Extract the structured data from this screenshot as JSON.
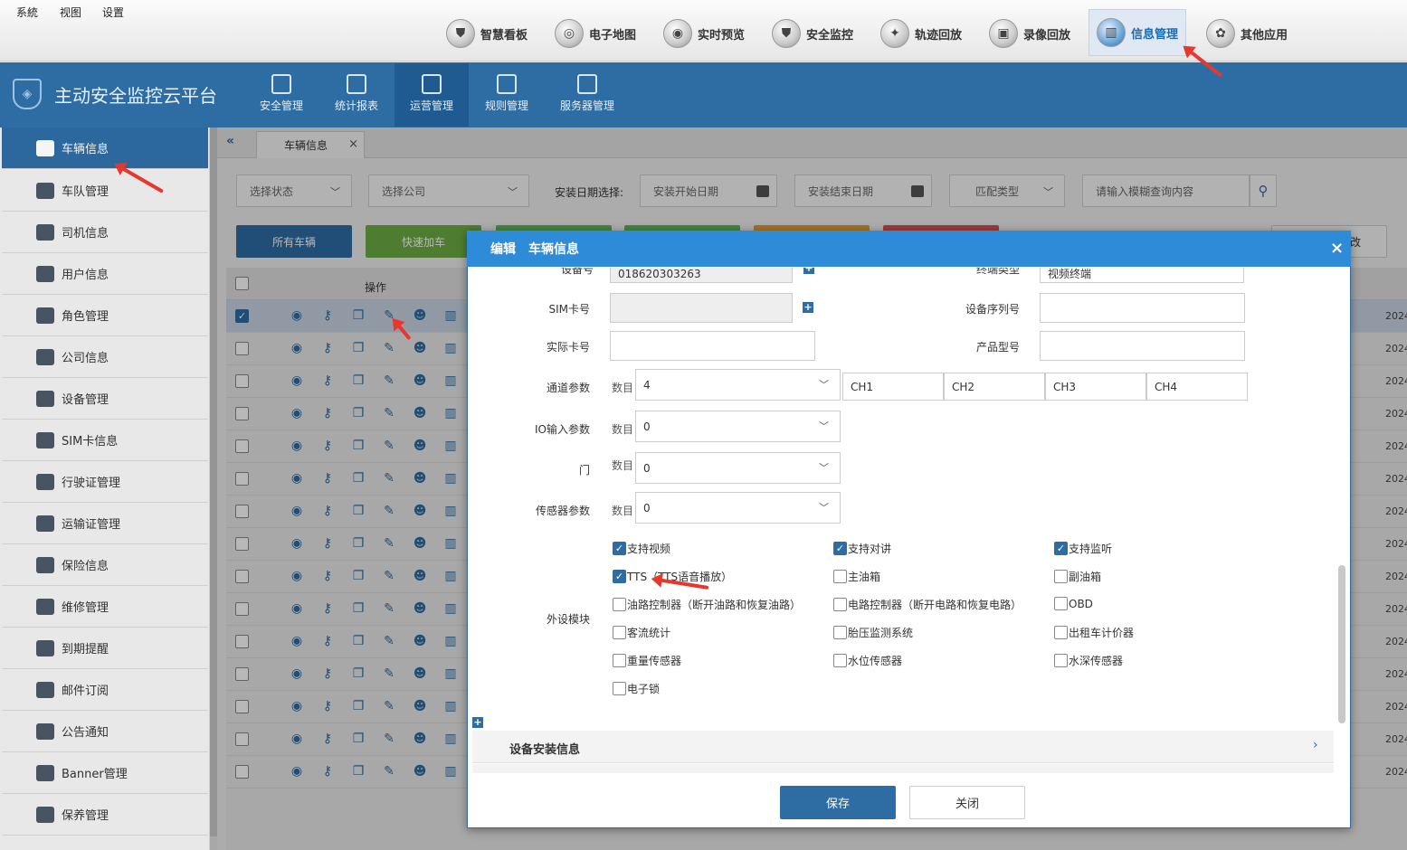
{
  "menu": {
    "system": "系統",
    "view": "视图",
    "settings": "设置"
  },
  "topnav": [
    {
      "label": "智慧看板",
      "icon": "shield-icon"
    },
    {
      "label": "电子地图",
      "icon": "map-icon"
    },
    {
      "label": "实时预览",
      "icon": "camera-icon"
    },
    {
      "label": "安全监控",
      "icon": "shield-icon"
    },
    {
      "label": "轨迹回放",
      "icon": "route-icon"
    },
    {
      "label": "录像回放",
      "icon": "video-icon"
    },
    {
      "label": "信息管理",
      "icon": "chart-icon",
      "active": true
    },
    {
      "label": "其他应用",
      "icon": "apps-icon"
    }
  ],
  "brand": {
    "title": "主动安全监控云平台"
  },
  "modules": [
    {
      "label": "安全管理"
    },
    {
      "label": "统计报表"
    },
    {
      "label": "运营管理",
      "active": true
    },
    {
      "label": "规则管理"
    },
    {
      "label": "服务器管理"
    }
  ],
  "sidebar": {
    "items": [
      {
        "label": "车辆信息",
        "active": true
      },
      {
        "label": "车队管理"
      },
      {
        "label": "司机信息"
      },
      {
        "label": "用户信息"
      },
      {
        "label": "角色管理"
      },
      {
        "label": "公司信息"
      },
      {
        "label": "设备管理"
      },
      {
        "label": "SIM卡信息"
      },
      {
        "label": "行驶证管理"
      },
      {
        "label": "运输证管理"
      },
      {
        "label": "保险信息"
      },
      {
        "label": "维修管理"
      },
      {
        "label": "到期提醒"
      },
      {
        "label": "邮件订阅"
      },
      {
        "label": "公告通知"
      },
      {
        "label": "Banner管理"
      },
      {
        "label": "保养管理"
      }
    ]
  },
  "tabs": {
    "current": "车辆信息",
    "close": "×",
    "collapse": "«"
  },
  "filters": {
    "status": "选择状态",
    "company": "选择公司",
    "date_label": "安装日期选择:",
    "start": "安装开始日期",
    "end": "安装结束日期",
    "match": "匹配类型",
    "search_placeholder": "请输入模糊查询内容"
  },
  "actions": {
    "all": "所有车辆",
    "quick": "快速加车",
    "partial_right": "改"
  },
  "table": {
    "op_header": "操作",
    "year": "2024",
    "right_digit": "4"
  },
  "modal": {
    "title": "编辑　车辆信息",
    "close": "×",
    "device_no_label": "设备号",
    "device_no_value": "018620303263",
    "terminal_type_label": "终端类型",
    "terminal_type_value": "视频终端",
    "sim_label": "SIM卡号",
    "serial_label": "设备序列号",
    "card_label": "实际卡号",
    "model_label": "产品型号",
    "channel_label": "通道参数",
    "count_label": "数目",
    "channel_count": "4",
    "channels": [
      "CH1",
      "CH2",
      "CH3",
      "CH4"
    ],
    "io_label": "IO输入参数",
    "io_count": "0",
    "door_label": "门",
    "door_count": "0",
    "sensor_label": "传感器参数",
    "sensor_count": "0",
    "peripheral_label": "外设模块",
    "peripherals": [
      {
        "label": "支持视频",
        "checked": true
      },
      {
        "label": "支持对讲",
        "checked": true
      },
      {
        "label": "支持监听",
        "checked": true
      },
      {
        "label": "TTS（TTS语音播放）",
        "checked": true
      },
      {
        "label": "主油箱",
        "checked": false
      },
      {
        "label": "副油箱",
        "checked": false
      },
      {
        "label": "油路控制器（断开油路和恢复油路）",
        "checked": false
      },
      {
        "label": "电路控制器（断开电路和恢复电路）",
        "checked": false
      },
      {
        "label": "OBD",
        "checked": false
      },
      {
        "label": "客流统计",
        "checked": false
      },
      {
        "label": "胎压监测系统",
        "checked": false
      },
      {
        "label": "出租车计价器",
        "checked": false
      },
      {
        "label": "重量传感器",
        "checked": false
      },
      {
        "label": "水位传感器",
        "checked": false
      },
      {
        "label": "水深传感器",
        "checked": false
      },
      {
        "label": "电子锁",
        "checked": false
      }
    ],
    "section_install": "设备安装信息",
    "save": "保存",
    "close_btn": "关闭"
  }
}
